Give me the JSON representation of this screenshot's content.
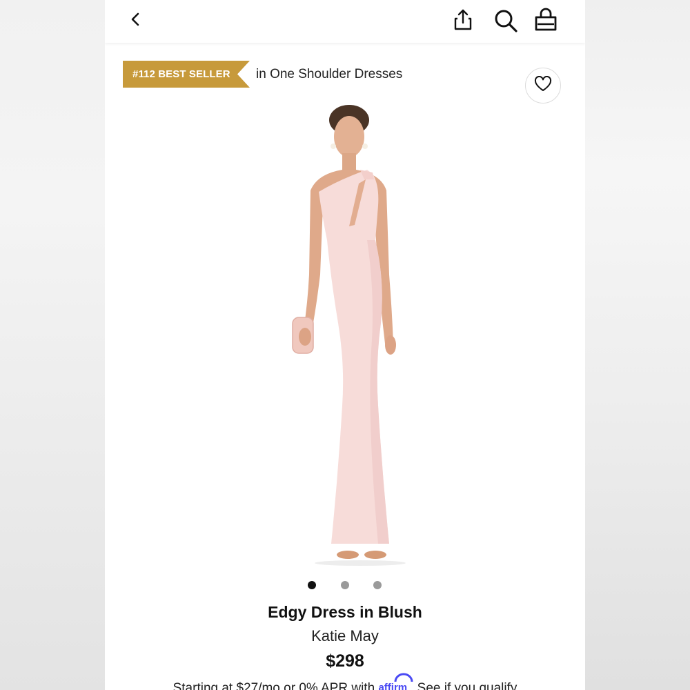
{
  "header": {
    "back_icon": "chevron-left-icon",
    "share_icon": "share-icon",
    "search_icon": "search-icon",
    "bag_icon": "shopping-bag-icon"
  },
  "bestseller": {
    "badge_text": "#112 BEST SELLER",
    "category_text": "in One Shoulder Dresses",
    "badge_color": "#c79a3b"
  },
  "wishlist": {
    "icon": "heart-icon"
  },
  "product": {
    "image_alt": "Model wearing a blush one-shoulder maxi gown holding a clutch",
    "dress_color": "#f7dcd9",
    "image_count": 3,
    "active_image": 1,
    "title": "Edgy Dress in Blush",
    "brand": "Katie May",
    "price": "$298"
  },
  "financing": {
    "prefix": "Starting at $27/mo or 0% APR with",
    "provider": "affirm",
    "link": ". See if you qualify"
  },
  "colors": {
    "accent_gold": "#c79a3b",
    "affirm_blue": "#4a4af4",
    "text_dark": "#111111"
  }
}
